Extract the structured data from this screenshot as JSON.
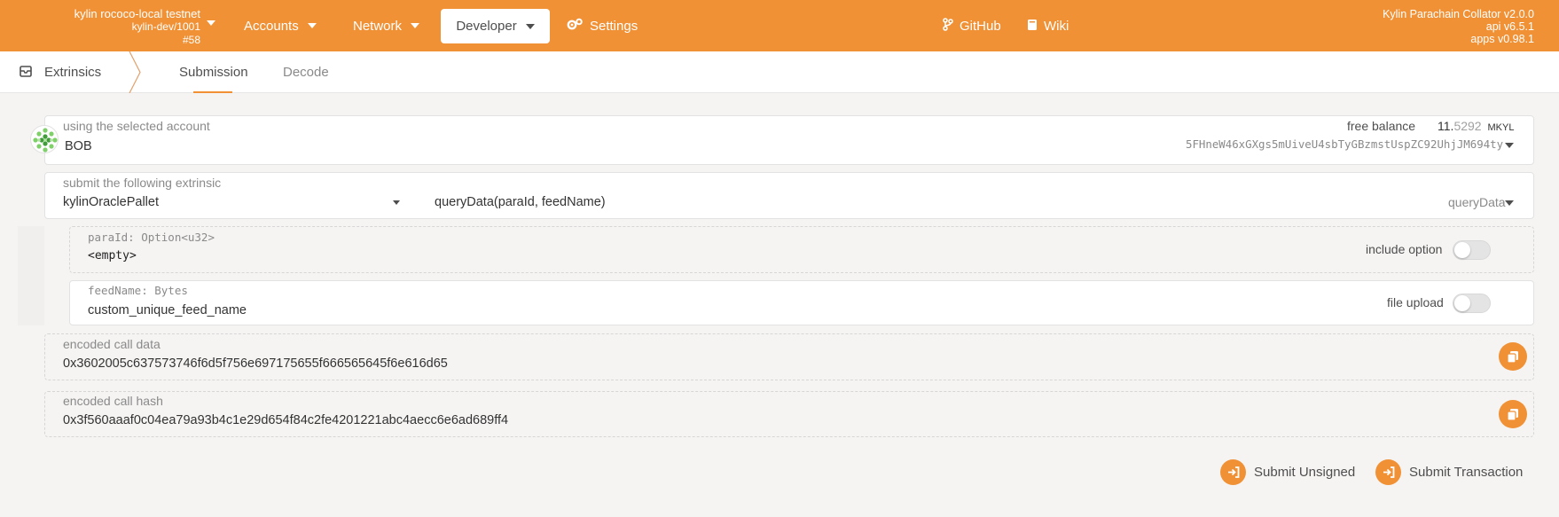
{
  "topbar": {
    "chain_name": "kylin rococo-local testnet",
    "chain_sub": "kylin-dev/1001",
    "block": "#58",
    "nav": {
      "accounts": "Accounts",
      "network": "Network",
      "developer": "Developer",
      "settings": "Settings",
      "github": "GitHub",
      "wiki": "Wiki"
    },
    "version": {
      "node": "Kylin Parachain Collator v2.0.0",
      "api": "api v6.5.1",
      "apps": "apps v0.98.1"
    },
    "colors": {
      "accent": "#f19135"
    }
  },
  "subnav": {
    "section": "Extrinsics",
    "tabs": [
      "Submission",
      "Decode"
    ]
  },
  "account": {
    "label": "using the selected account",
    "name": "BOB",
    "balance_label": "free balance",
    "balance_int": "11.",
    "balance_dec": "5292",
    "balance_unit": "MKYL",
    "address": "5FHneW46xGXgs5mUiveU4sbTyGBzmstUspZC92UhjJM694ty"
  },
  "extrinsic": {
    "label": "submit the following extrinsic",
    "pallet": "kylinOraclePallet",
    "call_signature": "queryData(paraId, feedName)",
    "method": "queryData"
  },
  "params": [
    {
      "label": "paraId: Option<u32>",
      "value": "<empty>",
      "option_label": "include option"
    },
    {
      "label": "feedName: Bytes",
      "value": "custom_unique_feed_name",
      "option_label": "file upload"
    }
  ],
  "encoded": {
    "data_label": "encoded call data",
    "data_value": "0x3602005c637573746f6d5f756e697175655f666565645f6e616d65",
    "hash_label": "encoded call hash",
    "hash_value": "0x3f560aaaf0c04ea79a93b4c1e29d654f84c2fe4201221abc4aecc6e6ad689ff4"
  },
  "actions": {
    "submit_unsigned": "Submit Unsigned",
    "submit_transaction": "Submit Transaction"
  }
}
